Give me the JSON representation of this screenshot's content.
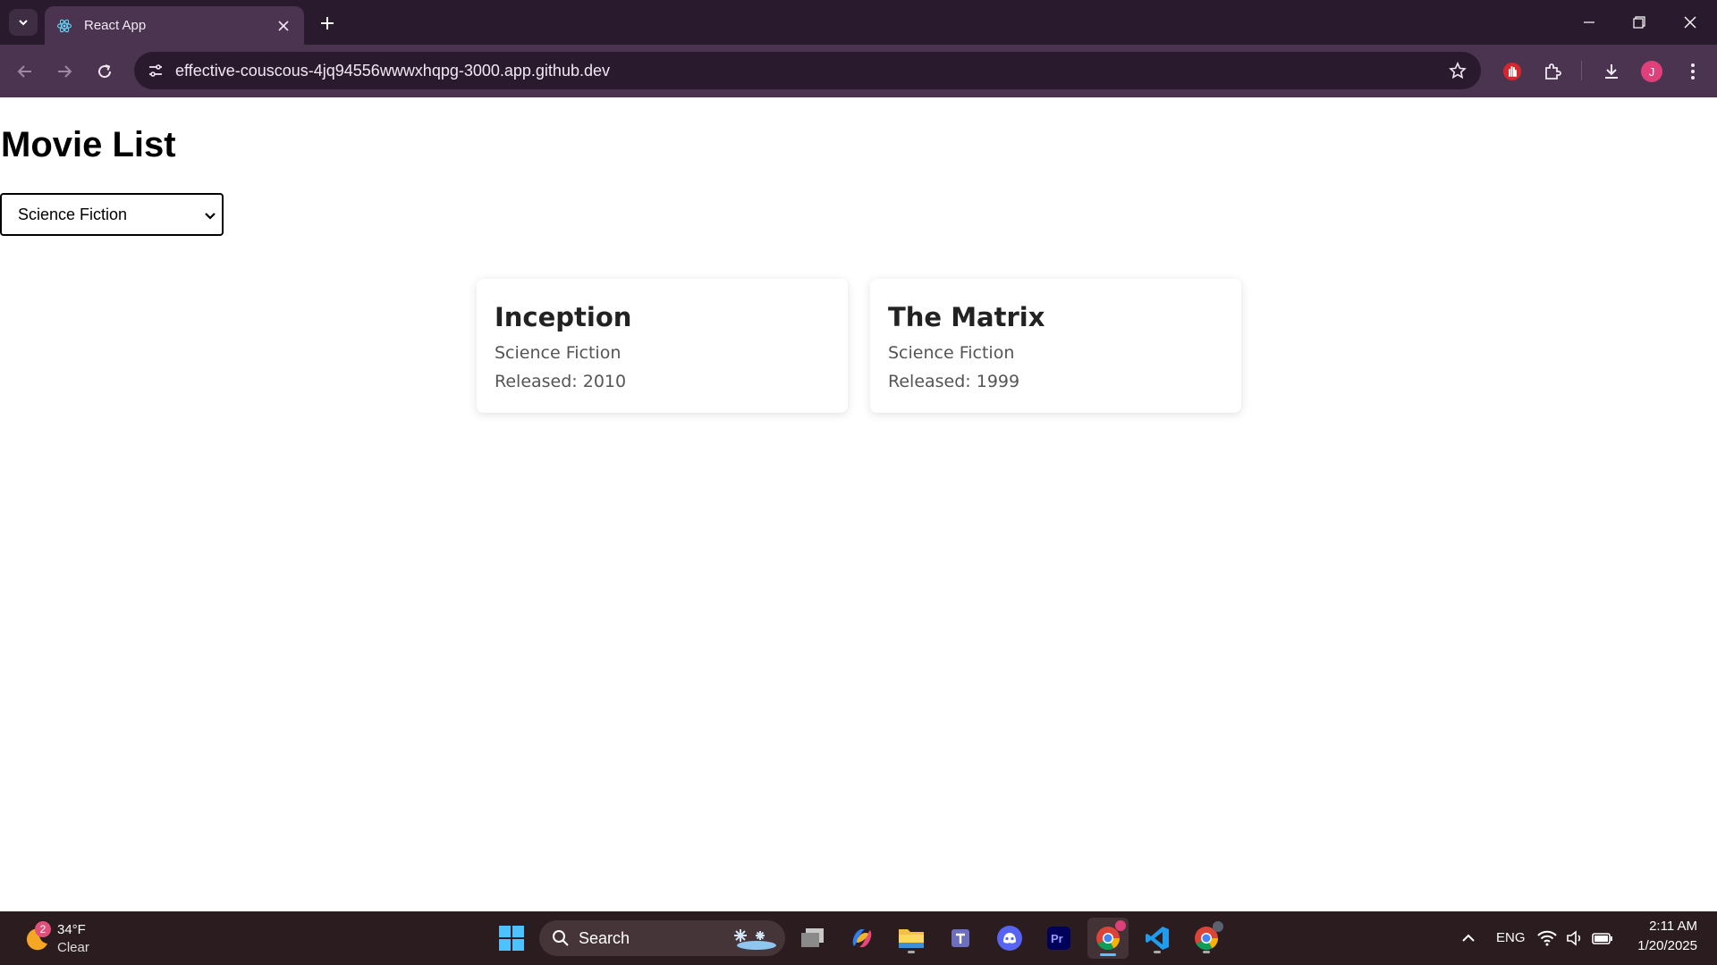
{
  "browser": {
    "tab_title": "React App",
    "url": "effective-couscous-4jq94556wwwxhqpg-3000.app.github.dev",
    "profile_initial": "J"
  },
  "page": {
    "title": "Movie List",
    "genre_select": {
      "selected": "Science Fiction"
    },
    "movies": [
      {
        "title": "Inception",
        "genre": "Science Fiction",
        "released": "Released: 2010"
      },
      {
        "title": "The Matrix",
        "genre": "Science Fiction",
        "released": "Released: 1999"
      }
    ]
  },
  "taskbar": {
    "weather": {
      "badge": "2",
      "temp": "34°F",
      "condition": "Clear"
    },
    "search_label": "Search",
    "language": "ENG",
    "time": "2:11 AM",
    "date": "1/20/2025"
  },
  "colors": {
    "titlebar": "#2a1a2e",
    "toolbar": "#4a3450",
    "taskbar": "#2b1c1f",
    "profile": "#e0407a"
  }
}
